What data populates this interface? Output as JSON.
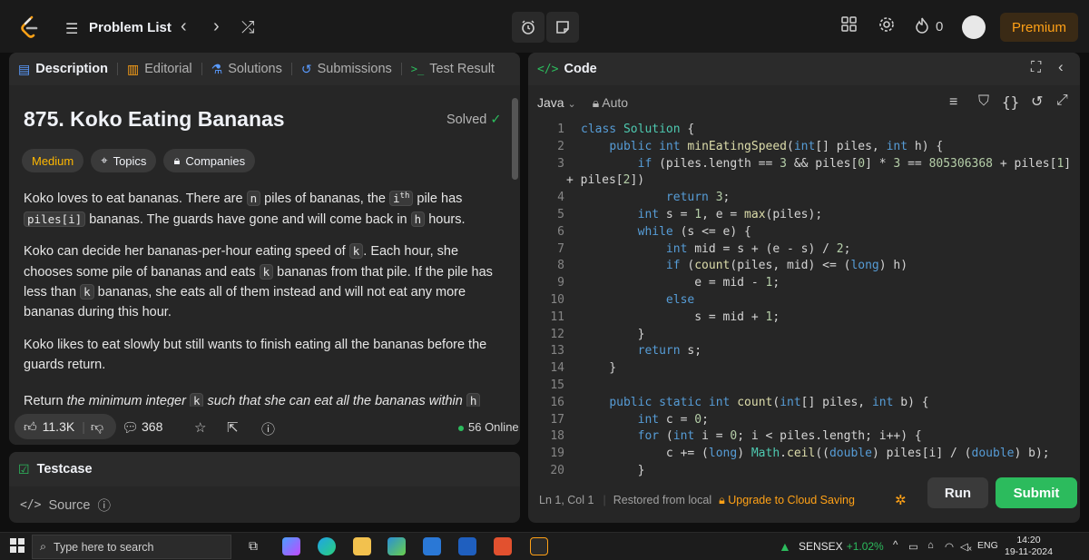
{
  "topbar": {
    "problem_list": "Problem List",
    "prev_arrow": "‹",
    "next_arrow": "›",
    "shuffle": "⤮",
    "streak_count": "0",
    "premium": "Premium"
  },
  "description": {
    "tabs": [
      {
        "label": "Description",
        "icon": "description-icon"
      },
      {
        "label": "Editorial",
        "icon": "book-icon"
      },
      {
        "label": "Solutions",
        "icon": "flask-icon"
      },
      {
        "label": "Submissions",
        "icon": "history-icon"
      },
      {
        "label": "Test Result",
        "icon": "terminal-icon"
      }
    ],
    "title": "875. Koko Eating Bananas",
    "status": "Solved",
    "chips": {
      "difficulty": "Medium",
      "topics": "Topics",
      "companies": "Companies"
    },
    "para1": {
      "a": "Koko loves to eat bananas. There are ",
      "n": "n",
      "b": " piles of bananas, the ",
      "ith": "i",
      "th": "th",
      "c": " pile has",
      "piles_i": "piles[i]",
      "d": " bananas. The guards have gone and will come back in ",
      "h": "h",
      "e": " hours."
    },
    "para2": {
      "a": "Koko can decide her bananas-per-hour eating speed of ",
      "k1": "k",
      "b": ". Each hour, she chooses some pile of bananas and eats ",
      "k2": "k",
      "c": " bananas from that pile. If the pile has less than ",
      "k3": "k",
      "d": " bananas, she eats all of them instead and will not eat any more bananas during this hour."
    },
    "para3": "Koko likes to eat slowly but still wants to finish eating all the bananas before the guards return.",
    "para4": {
      "a": "Return ",
      "b": "the minimum integer ",
      "k": "k",
      "c": " such that she can eat all the bananas within ",
      "h": "h"
    },
    "footer": {
      "likes": "11.3K",
      "comments": "368",
      "online": "56 Online"
    }
  },
  "testcase": {
    "title": "Testcase",
    "source": "Source"
  },
  "code": {
    "title": "Code",
    "language": "Java",
    "mode": "Auto",
    "lines": [
      {
        "n": "1",
        "t": "class Solution {"
      },
      {
        "n": "2",
        "t": "    public int minEatingSpeed(int[] piles, int h) {"
      },
      {
        "n": "3",
        "t": "        if (piles.length == 3 && piles[0] * 3 == 805306368 + piles[1]"
      },
      {
        "n": "",
        "t": "+ piles[2])"
      },
      {
        "n": "4",
        "t": "            return 3;"
      },
      {
        "n": "5",
        "t": "        int s = 1, e = max(piles);"
      },
      {
        "n": "6",
        "t": "        while (s <= e) {"
      },
      {
        "n": "7",
        "t": "            int mid = s + (e - s) / 2;"
      },
      {
        "n": "8",
        "t": "            if (count(piles, mid) <= (long) h)"
      },
      {
        "n": "9",
        "t": "                e = mid - 1;"
      },
      {
        "n": "10",
        "t": "            else"
      },
      {
        "n": "11",
        "t": "                s = mid + 1;"
      },
      {
        "n": "12",
        "t": "        }"
      },
      {
        "n": "13",
        "t": "        return s;"
      },
      {
        "n": "14",
        "t": "    }"
      },
      {
        "n": "15",
        "t": ""
      },
      {
        "n": "16",
        "t": "    public static int count(int[] piles, int b) {"
      },
      {
        "n": "17",
        "t": "        int c = 0;"
      },
      {
        "n": "18",
        "t": "        for (int i = 0; i < piles.length; i++) {"
      },
      {
        "n": "19",
        "t": "            c += (long) Math.ceil((double) piles[i] / (double) b);"
      },
      {
        "n": "20",
        "t": "        }"
      }
    ],
    "footer": {
      "position": "Ln 1, Col 1",
      "restored": "Restored from local",
      "upgrade": "Upgrade to Cloud Saving",
      "run": "Run",
      "submit": "Submit"
    }
  },
  "taskbar": {
    "search_placeholder": "Type here to search",
    "sensex": "SENSEX",
    "sensex_pct": "+1.02%",
    "lang": "ENG",
    "time": "14:20",
    "date": "19-11-2024"
  },
  "colors": {
    "accent_green": "#2cbb5d",
    "medium": "#ffb800",
    "premium": "#ffa116"
  }
}
